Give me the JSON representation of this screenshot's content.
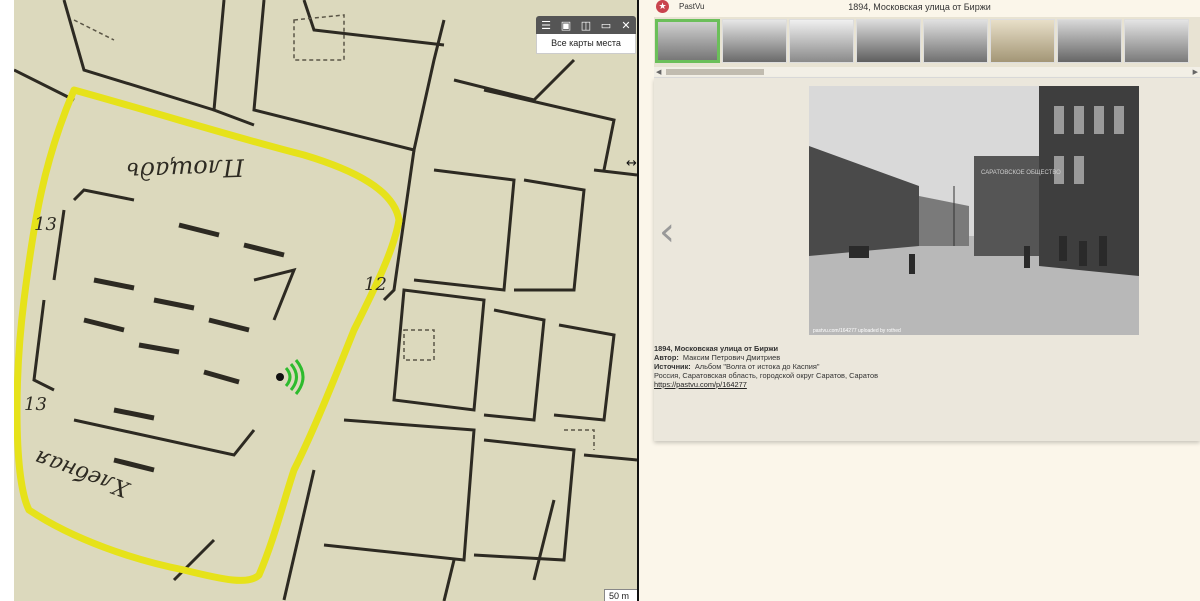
{
  "map": {
    "toolbar_icons": [
      "list-icon",
      "image-icon",
      "split-view-icon",
      "window-icon",
      "close-icon"
    ],
    "toolbar_label": "Все карты места",
    "scale": "50 m",
    "street_labels": [
      "Площадь",
      "Хлебная",
      "13",
      "12",
      "13"
    ],
    "highlight_color": "#e6e21a"
  },
  "pastvu": {
    "brand": "PastVu",
    "title": "1894, Московская улица от Биржи",
    "thumbnails": 8,
    "active_thumbnail": 0,
    "photo_credit": "pastvu.com/164277  uploaded by rothed",
    "caption": {
      "title": "1894, Московская улица от Биржи",
      "author_label": "Автор:",
      "author": "Максим Петрович Дмитриев",
      "source_label": "Источник:",
      "source": "Альбом \"Волга от истока до Каспия\"",
      "location": "Россия, Саратовская область, городской округ Саратов, Саратов",
      "url": "https://pastvu.com/p/164277"
    },
    "photo_sign": "САРАТОВСКОЕ ОБЩЕСТВО"
  },
  "colors": {
    "accent": "#c9444e",
    "active_thumb": "#6bbf5a",
    "background": "#fbf6ea"
  }
}
